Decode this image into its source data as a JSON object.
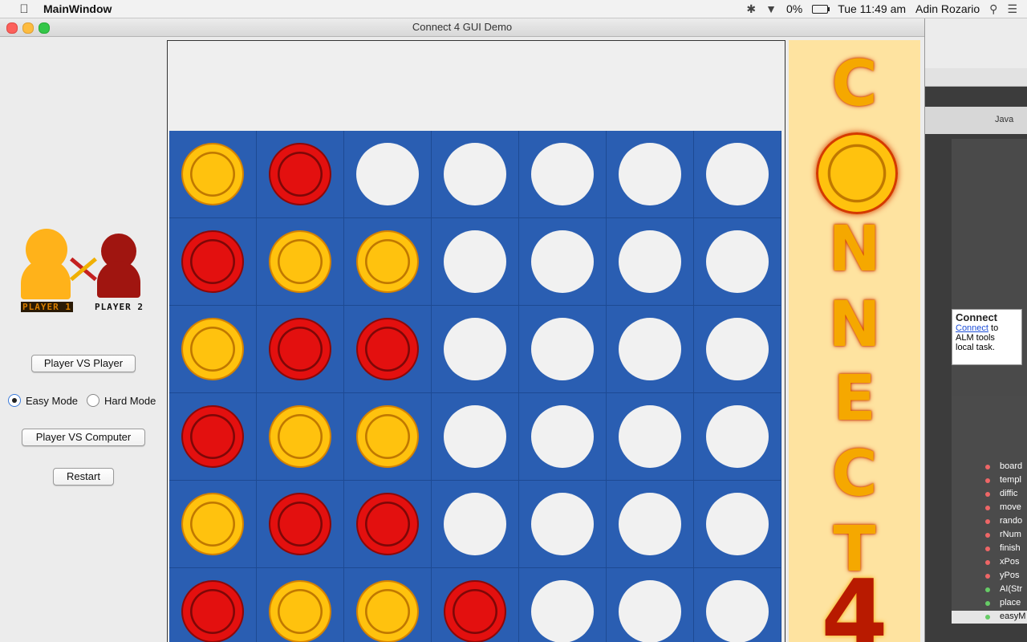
{
  "menubar": {
    "app_name": "MainWindow",
    "battery_text": "0%",
    "clock": "Tue 11:49 am",
    "user": "Adin Rozario"
  },
  "window": {
    "title": "Connect 4 GUI Demo"
  },
  "players": {
    "p1_label": "PLAYER 1",
    "p2_label": "PLAYER 2"
  },
  "controls": {
    "pvp_label": "Player VS Player",
    "easy_label": "Easy Mode",
    "hard_label": "Hard Mode",
    "mode_selected": "easy",
    "pvc_label": "Player VS Computer",
    "restart_label": "Restart"
  },
  "board": {
    "rows": [
      [
        "yellow",
        "red",
        "empty",
        "empty",
        "empty",
        "empty",
        "empty"
      ],
      [
        "red",
        "yellow",
        "yellow",
        "empty",
        "empty",
        "empty",
        "empty"
      ],
      [
        "yellow",
        "red",
        "red",
        "empty",
        "empty",
        "empty",
        "empty"
      ],
      [
        "red",
        "yellow",
        "yellow",
        "empty",
        "empty",
        "empty",
        "empty"
      ],
      [
        "yellow",
        "red",
        "red",
        "empty",
        "empty",
        "empty",
        "empty"
      ],
      [
        "red",
        "yellow",
        "yellow",
        "red",
        "empty",
        "empty",
        "empty"
      ]
    ]
  },
  "banner": {
    "letters": [
      "C",
      "N",
      "N",
      "E",
      "C",
      "T",
      "4"
    ]
  },
  "ide": {
    "info_title": "Connect",
    "info_link": "Connect",
    "info_text_1": "to",
    "info_text_2": "ALM tools",
    "info_text_3": "local task.",
    "lang": "Java",
    "outline": [
      "board",
      "templ",
      "diffic",
      "move",
      "rando",
      "rNum",
      "finish",
      "xPos",
      "yPos",
      "AI(Str",
      "place",
      "easyM"
    ]
  },
  "colors": {
    "board_blue": "#2a5eb2",
    "yellow_disc": "#ffc20e",
    "red_disc": "#e3100f",
    "banner_bg": "#fee3a0"
  }
}
